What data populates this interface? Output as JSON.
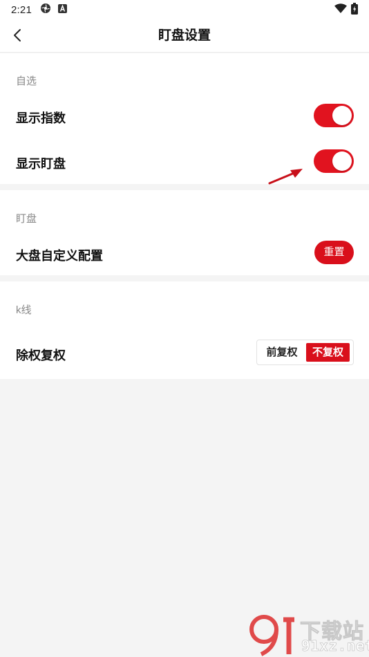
{
  "status_bar": {
    "time": "2:21",
    "icons": [
      "settings-flower-icon",
      "app-a-icon",
      "wifi-icon",
      "battery-charging-icon"
    ]
  },
  "header": {
    "title": "盯盘设置",
    "back_icon": "chevron-left-icon"
  },
  "sections": {
    "watchlist": {
      "label": "自选",
      "rows": [
        {
          "label": "显示指数",
          "control": "toggle",
          "checked": true
        },
        {
          "label": "显示盯盘",
          "control": "toggle",
          "checked": true
        }
      ]
    },
    "monitor": {
      "label": "盯盘",
      "rows": [
        {
          "label": "大盘自定义配置",
          "control": "button",
          "button_label": "重置"
        }
      ]
    },
    "kline": {
      "label": "k线",
      "rows": [
        {
          "label": "除权复权",
          "control": "segmented",
          "options": [
            "前复权",
            "不复权"
          ],
          "selected": "不复权"
        }
      ]
    }
  },
  "colors": {
    "accent": "#e1131f",
    "background": "#f4f4f4",
    "card": "#ffffff",
    "section_label": "#888888"
  },
  "watermark": {
    "logo": "9f-logo",
    "text_big": "下载站",
    "text_small": "91xz.net"
  }
}
